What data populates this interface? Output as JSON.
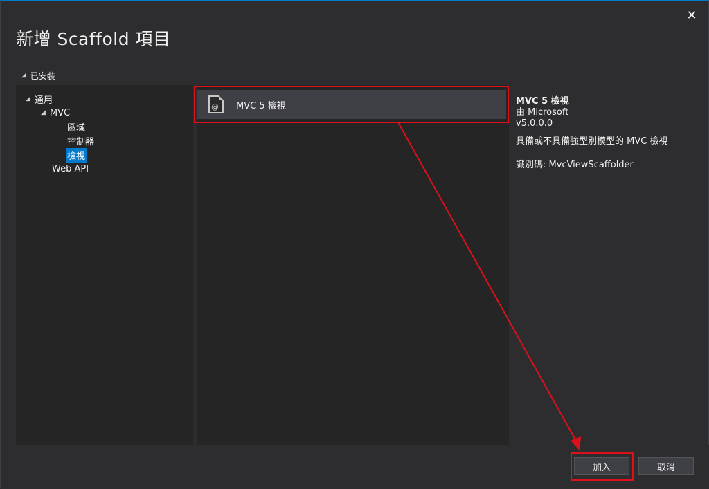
{
  "dialog": {
    "title": "新增 Scaffold 項目",
    "close_glyph": "✕"
  },
  "tree": {
    "header": "已安裝",
    "nodes": [
      {
        "label": "通用",
        "level": 0,
        "expanded": true
      },
      {
        "label": "MVC",
        "level": 1,
        "expanded": true
      },
      {
        "label": "區域",
        "level": 2
      },
      {
        "label": "控制器",
        "level": 2
      },
      {
        "label": "檢視",
        "level": 2,
        "selected": true
      },
      {
        "label": "Web API",
        "level": 1
      }
    ]
  },
  "templates": [
    {
      "label": "MVC 5 檢視",
      "icon": "razor-file-icon",
      "icon_glyph": "@",
      "selected": true
    }
  ],
  "details": {
    "name": "MVC 5 檢視",
    "author": "由 Microsoft",
    "version": "v5.0.0.0",
    "description": "具備或不具備強型別模型的 MVC 檢視",
    "id_text": "識別碼: MvcViewScaffolder"
  },
  "buttons": {
    "add": "加入",
    "cancel": "取消"
  },
  "colors": {
    "accent": "#007acc",
    "annotation": "#e0101a"
  }
}
